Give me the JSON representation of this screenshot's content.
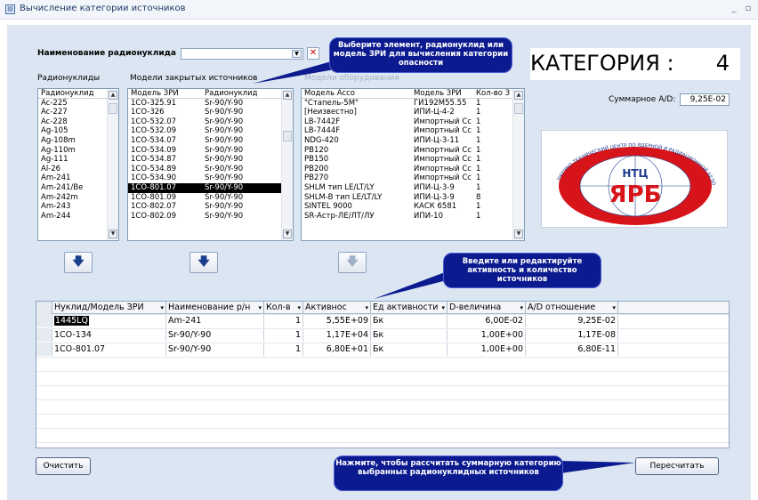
{
  "window": {
    "title": "Вычисление категории источников"
  },
  "form": {
    "radionuclide_label": "Наименование радионуклида",
    "radionuclide_value": "",
    "col1_caption": "Радионуклиды",
    "col2_caption": "Модели закрытых источников",
    "col3_caption": "Модели оборудования",
    "category_label": "КАТЕГОРИЯ :",
    "category_value": "4",
    "sum_label": "Суммарное A/D:",
    "sum_value": "9,25E-02",
    "clear_button": "Очистить",
    "recalc_button": "Пересчитать"
  },
  "callouts": {
    "select": "Выберите элемент, радионуклид или модель ЗРИ для вычисления категории опасности",
    "edit": "Введите или редактируйте активность и количество источников",
    "recalc": "Нажмите, чтобы рассчитать суммарную категорию  выбранных радионуклидных источников"
  },
  "list1": {
    "header": "Радионуклид",
    "items": [
      "Ac-225",
      "Ac-227",
      "Ac-228",
      "Ag-105",
      "Ag-108m",
      "Ag-110m",
      "Ag-111",
      "Al-26",
      "Am-241",
      "Am-241/Be",
      "Am-242m",
      "Am-243",
      "Am-244"
    ]
  },
  "list2": {
    "headers": [
      "Модель ЗРИ",
      "Радионуклид"
    ],
    "rows": [
      [
        "1CO-325.91",
        "Sr-90/Y-90"
      ],
      [
        "1CO-326",
        "Sr-90/Y-90"
      ],
      [
        "1CO-532.07",
        "Sr-90/Y-90"
      ],
      [
        "1CO-532.09",
        "Sr-90/Y-90"
      ],
      [
        "1CO-534.07",
        "Sr-90/Y-90"
      ],
      [
        "1CO-534.09",
        "Sr-90/Y-90"
      ],
      [
        "1CO-534.87",
        "Sr-90/Y-90"
      ],
      [
        "1CO-534.89",
        "Sr-90/Y-90"
      ],
      [
        "1CO-534.90",
        "Sr-90/Y-90"
      ],
      [
        "1CO-801.07",
        "Sr-90/Y-90"
      ],
      [
        "1CO-801.09",
        "Sr-90/Y-90"
      ],
      [
        "1CO-802.07",
        "Sr-90/Y-90"
      ],
      [
        "1CO-802.09",
        "Sr-90/Y-90"
      ]
    ],
    "selected_index": 9
  },
  "list3": {
    "headers": [
      "Модель Acco",
      "Модель ЗРИ",
      "Кол-во З"
    ],
    "rows": [
      [
        "\"Стапель-5М\"",
        "ГИ192M55.55",
        "1"
      ],
      [
        "[Неизвестно]",
        "ИПИ-Ц-4-2",
        "1"
      ],
      [
        "LB-7442F",
        "Импортный Сс",
        "1"
      ],
      [
        "LB-7444F",
        "Импортный Сс",
        "1"
      ],
      [
        "NDG-420",
        "ИПИ-Ц-3-11",
        "1"
      ],
      [
        "PB120",
        "Импортный Сс",
        "1"
      ],
      [
        "PB150",
        "Импортный Сс",
        "1"
      ],
      [
        "PB200",
        "Импортный Сс",
        "1"
      ],
      [
        "PB270",
        "Импортный Сс",
        "1"
      ],
      [
        "SHLM тип LE/LT/LY",
        "ИПИ-Ц-3-9",
        "1"
      ],
      [
        "SHLM-B тип LE/LT/LY",
        "ИПИ-Ц-3-9",
        "8"
      ],
      [
        "SINTEL 9000",
        "КАСК 6581",
        "1"
      ],
      [
        "SR-Астр-ЛЕ/ЛТ/ЛУ",
        "ИПИ-10",
        "1"
      ]
    ]
  },
  "logo": {
    "top_text": "НАУЧНО-ТЕХНИЧЕСКИЙ ЦЕНТР ПО ЯДЕРНОЙ И РАДИАЦИОННОЙ БЕЗОПАСНОСТИ",
    "ntc": "НТЦ",
    "yarb": "ЯРБ"
  },
  "table": {
    "headers": [
      "Нуклид/Модель ЗРИ",
      "Наименование р/н",
      "Кол-в",
      "Активнос",
      "Ед активности",
      "D-величина",
      "A/D отношение"
    ],
    "rows": [
      [
        "1445LQ",
        "Am-241",
        "1",
        "5,55E+09",
        "Бк",
        "6,00E-02",
        "9,25E-02"
      ],
      [
        "1CO-134",
        "Sr-90/Y-90",
        "1",
        "1,17E+04",
        "Бк",
        "1,00E+00",
        "1,17E-08"
      ],
      [
        "1CO-801.07",
        "Sr-90/Y-90",
        "1",
        "6,80E+01",
        "Бк",
        "1,00E+00",
        "6,80E-11"
      ]
    ]
  },
  "colors": {
    "callout_bg": "#0b1a8f",
    "form_bg": "#dce6f2",
    "logo_red": "#d8141b",
    "logo_blue": "#1d3c8c"
  }
}
